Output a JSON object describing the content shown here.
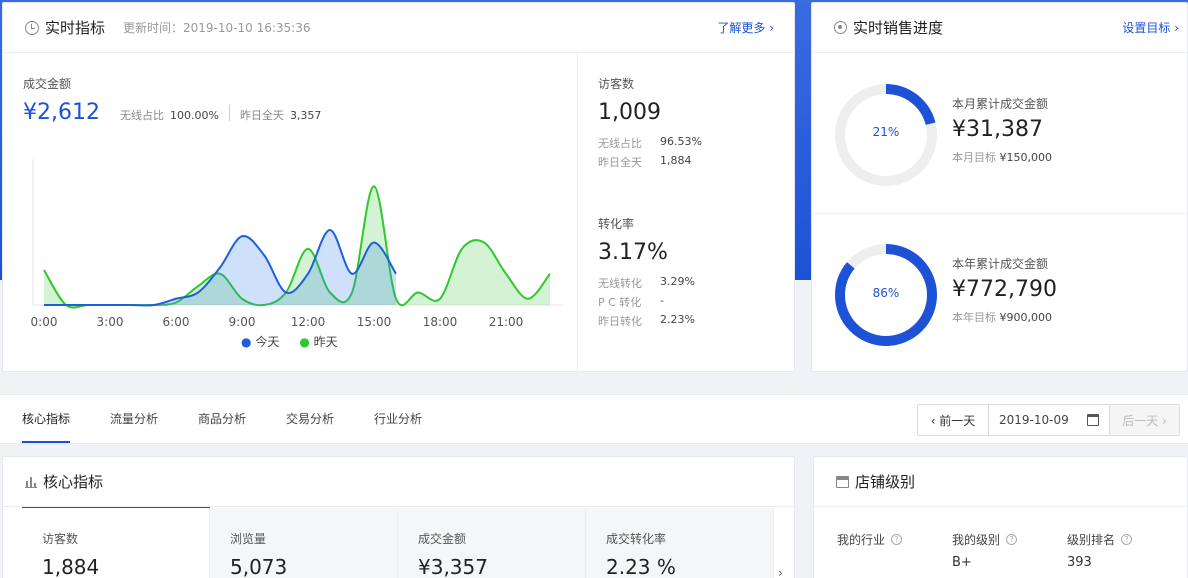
{
  "realtime": {
    "title": "实时指标",
    "updated": "更新时间：2019-10-10 16:35:36",
    "learn_more": "了解更多 ›",
    "gmv_label": "成交金额",
    "gmv_value": "¥2,612",
    "wireless_share_label": "无线占比",
    "wireless_share_value": "100.00%",
    "yesterday_label": "昨日全天",
    "yesterday_value": "3,357",
    "visitors_label": "访客数",
    "visitors_value": "1,009",
    "visitors_wireless_label": "无线占比",
    "visitors_wireless_value": "96.53%",
    "visitors_yesterday_label": "昨日全天",
    "visitors_yesterday_value": "1,884",
    "conv_label": "转化率",
    "conv_value": "3.17%",
    "conv_wireless_label": "无线转化",
    "conv_wireless_value": "3.29%",
    "conv_pc_label": "P C 转化",
    "conv_pc_value": "-",
    "conv_yesterday_label": "昨日转化",
    "conv_yesterday_value": "2.23%"
  },
  "chart_data": {
    "type": "area",
    "x": [
      0,
      1,
      2,
      3,
      4,
      5,
      6,
      7,
      8,
      9,
      10,
      11,
      12,
      13,
      14,
      15,
      16,
      17,
      18,
      19,
      20,
      21,
      22,
      23
    ],
    "xticks": [
      "0:00",
      "3:00",
      "6:00",
      "9:00",
      "12:00",
      "15:00",
      "18:00",
      "21:00"
    ],
    "series": [
      {
        "name": "今天",
        "color": "#1d5fe0",
        "values": [
          0,
          0,
          0,
          0,
          0,
          0,
          0.05,
          0.1,
          0.3,
          0.55,
          0.4,
          0.1,
          0.25,
          0.6,
          0.25,
          0.5,
          0.25
        ]
      },
      {
        "name": "昨天",
        "color": "#2ec92e",
        "values": [
          0.28,
          0,
          0,
          0,
          0,
          0,
          0.02,
          0.15,
          0.25,
          0.05,
          0,
          0.1,
          0.45,
          0.1,
          0.1,
          0.95,
          0.05,
          0.1,
          0.05,
          0.45,
          0.5,
          0.25,
          0.05,
          0.25
        ]
      }
    ]
  },
  "sales": {
    "title": "实时销售进度",
    "set_goal": "设置目标 ›",
    "month_pct": "21%",
    "month_pct_value": 0.21,
    "month_label": "本月累计成交金额",
    "month_value": "¥31,387",
    "month_goal_label": "本月目标",
    "month_goal_value": "¥150,000",
    "year_pct": "86%",
    "year_pct_value": 0.86,
    "year_label": "本年累计成交金额",
    "year_value": "¥772,790",
    "year_goal_label": "本年目标",
    "year_goal_value": "¥900,000",
    "accent": "#1d52d6"
  },
  "tabs": [
    "核心指标",
    "流量分析",
    "商品分析",
    "交易分析",
    "行业分析"
  ],
  "date_nav": {
    "prev": "‹ 前一天",
    "date": "2019-10-09",
    "next": "后一天 ›"
  },
  "core": {
    "title": "核心指标",
    "stats": [
      {
        "label": "访客数",
        "value": "1,884"
      },
      {
        "label": "浏览量",
        "value": "5,073"
      },
      {
        "label": "成交金额",
        "value": "¥3,357"
      },
      {
        "label": "成交转化率",
        "value": "2.23 %"
      }
    ]
  },
  "shop": {
    "title": "店铺级别",
    "industry_label": "我的行业",
    "level_label": "我的级别",
    "level_value": "B+",
    "rank_label": "级别排名",
    "rank_value": "393"
  }
}
